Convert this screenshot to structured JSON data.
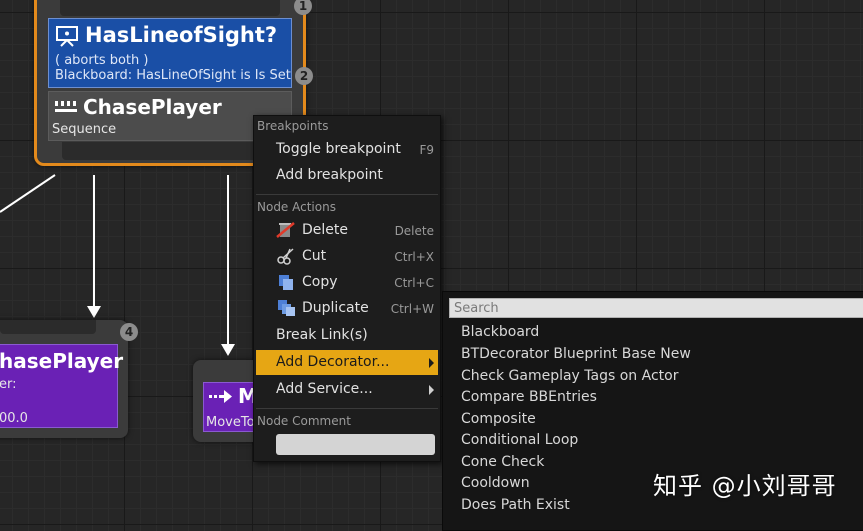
{
  "main_node": {
    "decorator_title": "HasLineofSight?",
    "decorator_aborts": "( aborts both )",
    "decorator_blackboard": "Blackboard: HasLineOfSight is Is Set",
    "decorator_badge": "2",
    "top_badge": "1",
    "composite_title": "ChasePlayer",
    "composite_type": "Sequence"
  },
  "left_node": {
    "title": "hasePlayer",
    "line2": "er:",
    "line3": "00.0",
    "badge": "4"
  },
  "mid_node": {
    "title": "M",
    "subtitle": "MoveTo"
  },
  "context_menu": {
    "section_breakpoints": "Breakpoints",
    "toggle_breakpoint": "Toggle breakpoint",
    "toggle_breakpoint_shortcut": "F9",
    "add_breakpoint": "Add breakpoint",
    "section_node_actions": "Node Actions",
    "delete": "Delete",
    "delete_shortcut": "Delete",
    "cut": "Cut",
    "cut_shortcut": "Ctrl+X",
    "copy": "Copy",
    "copy_shortcut": "Ctrl+C",
    "duplicate": "Duplicate",
    "duplicate_shortcut": "Ctrl+W",
    "break_links": "Break Link(s)",
    "add_decorator": "Add Decorator...",
    "add_service": "Add Service...",
    "section_node_comment": "Node Comment",
    "comment_value": ""
  },
  "decorator_submenu": {
    "search_placeholder": "Search",
    "items": [
      "Blackboard",
      "BTDecorator Blueprint Base New",
      "Check Gameplay Tags on Actor",
      "Compare BBEntries",
      "Composite",
      "Conditional Loop",
      "Cone Check",
      "Cooldown",
      "Does Path Exist"
    ]
  },
  "watermark": "知乎 @小刘哥哥",
  "colors": {
    "selected_border": "#e38a1c",
    "decorator_blue": "#1a4fa6",
    "task_purple": "#6a21b5",
    "menu_highlight": "#e6a614"
  },
  "icons": {
    "decorator": "monitor-eye-icon",
    "composite": "sequence-icon",
    "task": "move-arrow-icon",
    "delete": "delete-icon",
    "cut": "scissors-icon",
    "copy": "copy-icon",
    "duplicate": "duplicate-icon"
  }
}
